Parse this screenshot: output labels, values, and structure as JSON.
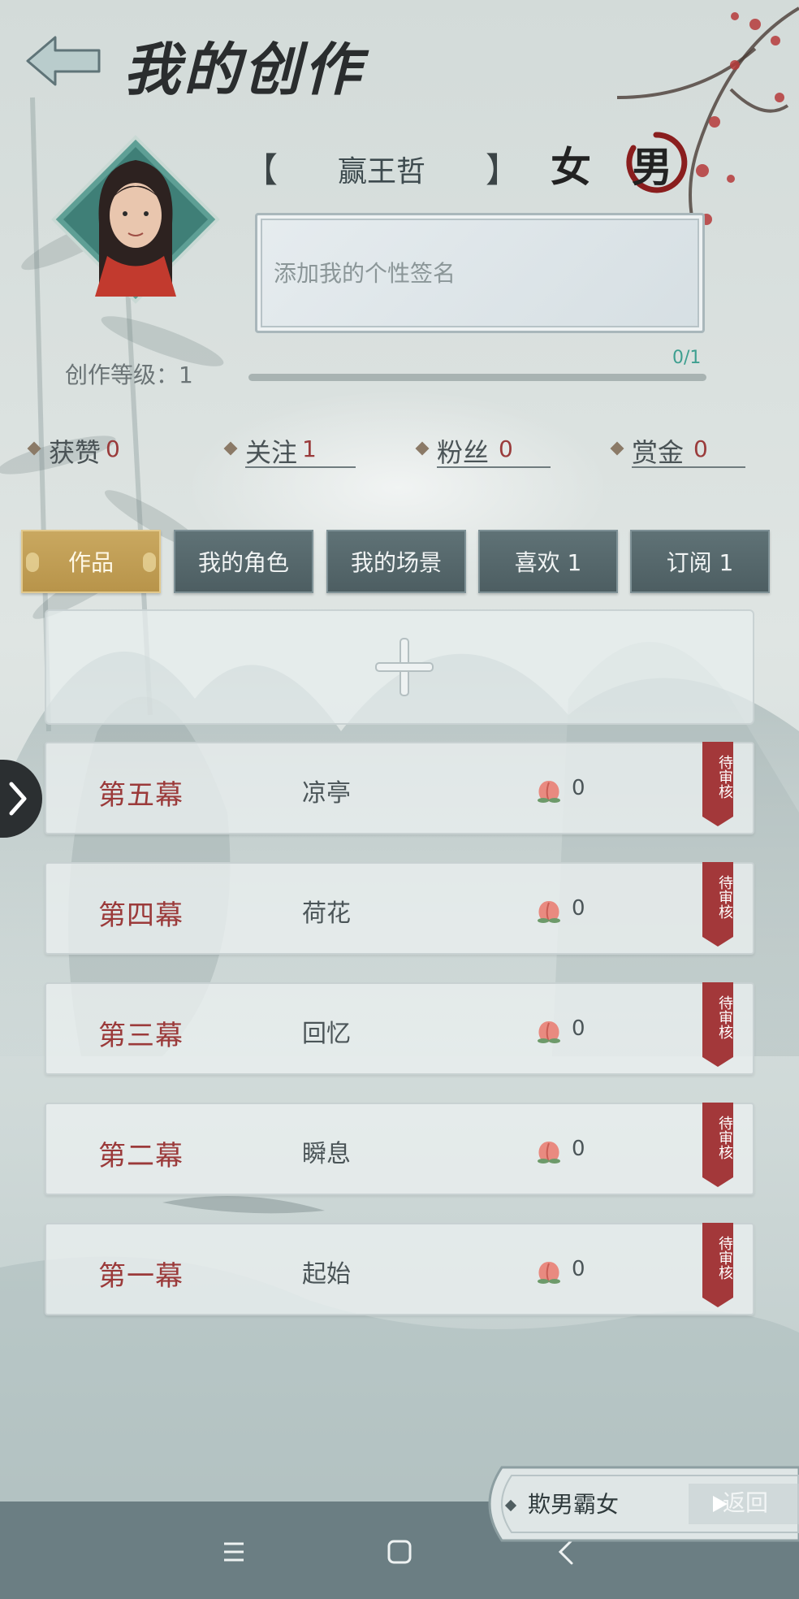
{
  "header": {
    "title": "我的创作"
  },
  "profile": {
    "name": "赢王哲",
    "gender_female": "女",
    "gender_male": "男",
    "gender_selected": "male",
    "signature_placeholder": "添加我的个性签名",
    "level_label": "创作等级：1",
    "exp_text": "0/1",
    "exp_progress": 0
  },
  "stats": [
    {
      "label": "获赞",
      "value": "0"
    },
    {
      "label": "关注",
      "value": "1"
    },
    {
      "label": "粉丝",
      "value": "0"
    },
    {
      "label": "赏金",
      "value": "0"
    }
  ],
  "tabs": [
    {
      "label": "作品",
      "active": true
    },
    {
      "label": "我的角色",
      "active": false
    },
    {
      "label": "我的场景",
      "active": false
    },
    {
      "label": "喜欢 1",
      "active": false
    },
    {
      "label": "订阅 1",
      "active": false
    }
  ],
  "scenes": [
    {
      "act": "第五幕",
      "name": "凉亭",
      "likes": "0",
      "status": "待审核"
    },
    {
      "act": "第四幕",
      "name": "荷花",
      "likes": "0",
      "status": "待审核"
    },
    {
      "act": "第三幕",
      "name": "回忆",
      "likes": "0",
      "status": "待审核"
    },
    {
      "act": "第二幕",
      "name": "瞬息",
      "likes": "0",
      "status": "待审核"
    },
    {
      "act": "第一幕",
      "name": "起始",
      "likes": "0",
      "status": "待审核"
    }
  ],
  "bottom_panel": {
    "nickname": "欺男霸女",
    "return_label": "返回"
  },
  "colors": {
    "accent_gold": "#c9a860",
    "tab_dark": "#5f7276",
    "act_red": "#9b3a3a",
    "exp_teal": "#3e9f90"
  },
  "icons": {
    "back": "back-arrow-icon",
    "add": "plus-icon",
    "like": "peach-icon",
    "review": "ribbon-tag-icon",
    "expand": "chevron-right-icon"
  }
}
